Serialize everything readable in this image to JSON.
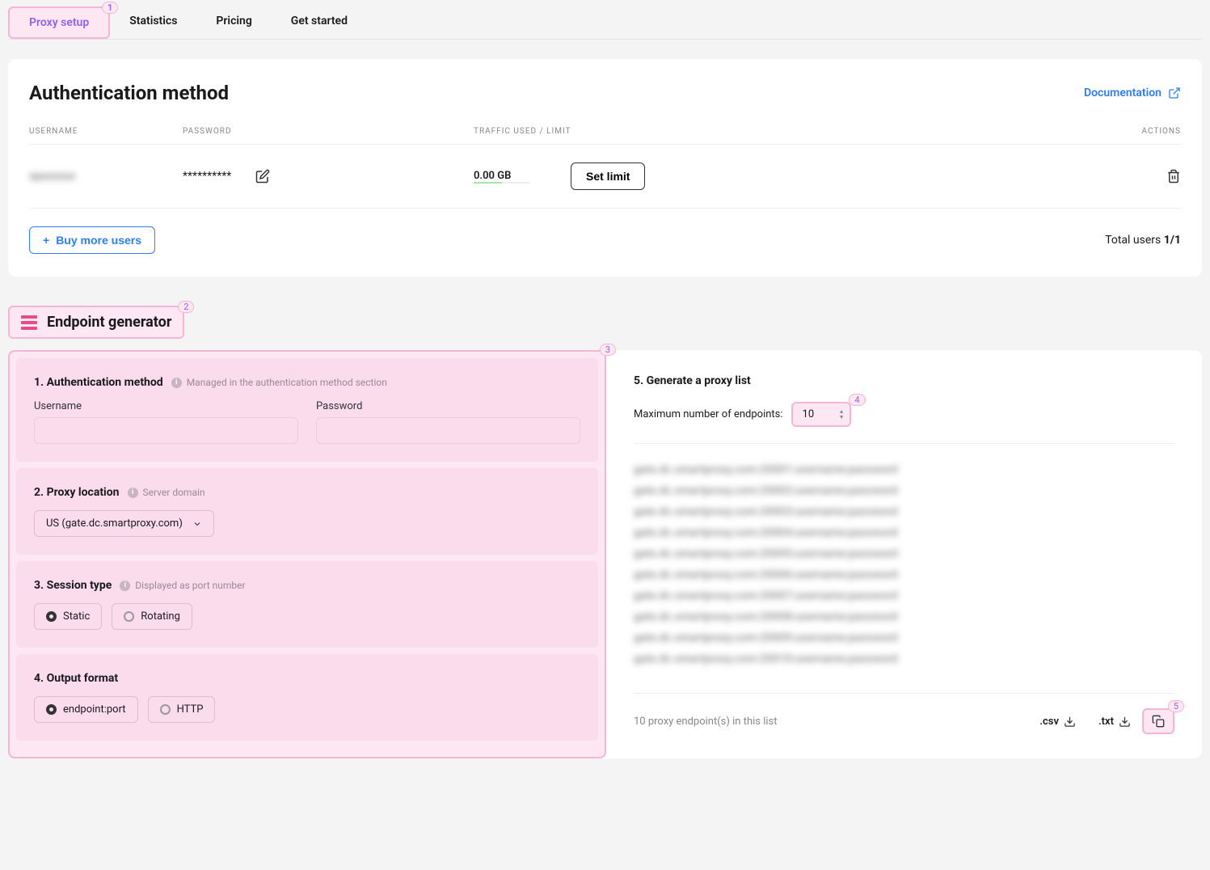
{
  "tabs": [
    {
      "label": "Proxy setup",
      "active": true,
      "badge": "1"
    },
    {
      "label": "Statistics"
    },
    {
      "label": "Pricing"
    },
    {
      "label": "Get started"
    }
  ],
  "auth_card": {
    "title": "Authentication method",
    "doc_link": "Documentation",
    "columns": {
      "user": "USERNAME",
      "pass": "PASSWORD",
      "traffic": "TRAFFIC USED / LIMIT",
      "actions": "ACTIONS"
    },
    "row": {
      "username": "xpxxxxxx",
      "password": "**********",
      "traffic": "0.00 GB",
      "set_limit": "Set limit"
    },
    "buy_more": "Buy more users",
    "total_label": "Total users ",
    "total_value": "1/1"
  },
  "eg_heading": {
    "title": "Endpoint generator",
    "badge": "2"
  },
  "left_badge": "3",
  "steps": {
    "s1": {
      "title": "1. Authentication method",
      "hint": "Managed in the authentication method section",
      "username_label": "Username",
      "password_label": "Password"
    },
    "s2": {
      "title": "2. Proxy location",
      "hint": "Server domain",
      "value": "US (gate.dc.smartproxy.com)"
    },
    "s3": {
      "title": "3. Session type",
      "hint": "Displayed as port number",
      "opt1": "Static",
      "opt2": "Rotating"
    },
    "s4": {
      "title": "4. Output format",
      "opt1": "endpoint:port",
      "opt2": "HTTP"
    }
  },
  "right": {
    "title": "5. Generate a proxy list",
    "max_label": "Maximum number of endpoints:",
    "max_value": "10",
    "badge": "4",
    "lines": [
      "gate.dc.smartproxy.com:20001:username:password",
      "gate.dc.smartproxy.com:20002:username:password",
      "gate.dc.smartproxy.com:20003:username:password",
      "gate.dc.smartproxy.com:20004:username:password",
      "gate.dc.smartproxy.com:20005:username:password",
      "gate.dc.smartproxy.com:20006:username:password",
      "gate.dc.smartproxy.com:20007:username:password",
      "gate.dc.smartproxy.com:20008:username:password",
      "gate.dc.smartproxy.com:20009:username:password",
      "gate.dc.smartproxy.com:20010:username:password"
    ],
    "count": "10 proxy endpoint(s) in this list",
    "csv": ".csv",
    "txt": ".txt",
    "copy_badge": "5"
  }
}
